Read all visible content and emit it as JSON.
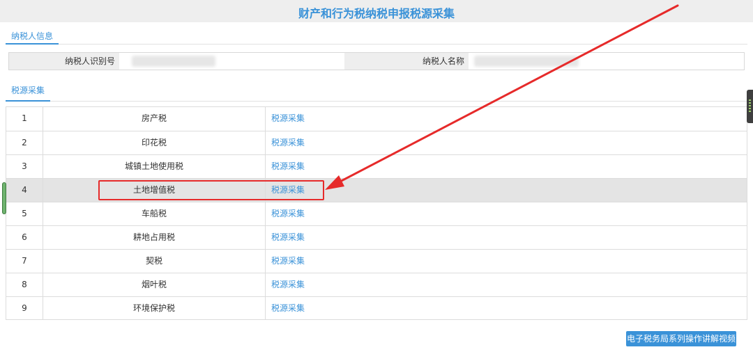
{
  "page_title": "财产和行为税纳税申报税源采集",
  "tabs": {
    "taxpayer_info": "纳税人信息",
    "source_collection": "税源采集"
  },
  "taxpayer": {
    "id_label": "纳税人识别号",
    "name_label": "纳税人名称"
  },
  "rows": [
    {
      "index": "1",
      "name": "房产税",
      "action": "税源采集"
    },
    {
      "index": "2",
      "name": "印花税",
      "action": "税源采集"
    },
    {
      "index": "3",
      "name": "城镇土地使用税",
      "action": "税源采集"
    },
    {
      "index": "4",
      "name": "土地增值税",
      "action": "税源采集"
    },
    {
      "index": "5",
      "name": "车船税",
      "action": "税源采集"
    },
    {
      "index": "6",
      "name": "耕地占用税",
      "action": "税源采集"
    },
    {
      "index": "7",
      "name": "契税",
      "action": "税源采集"
    },
    {
      "index": "8",
      "name": "烟叶税",
      "action": "税源采集"
    },
    {
      "index": "9",
      "name": "环境保护税",
      "action": "税源采集"
    }
  ],
  "highlighted_row": 4,
  "help_button": "电子税务局系列操作讲解视频",
  "colors": {
    "accent": "#3a92d8",
    "annotation": "#e62a2a"
  }
}
